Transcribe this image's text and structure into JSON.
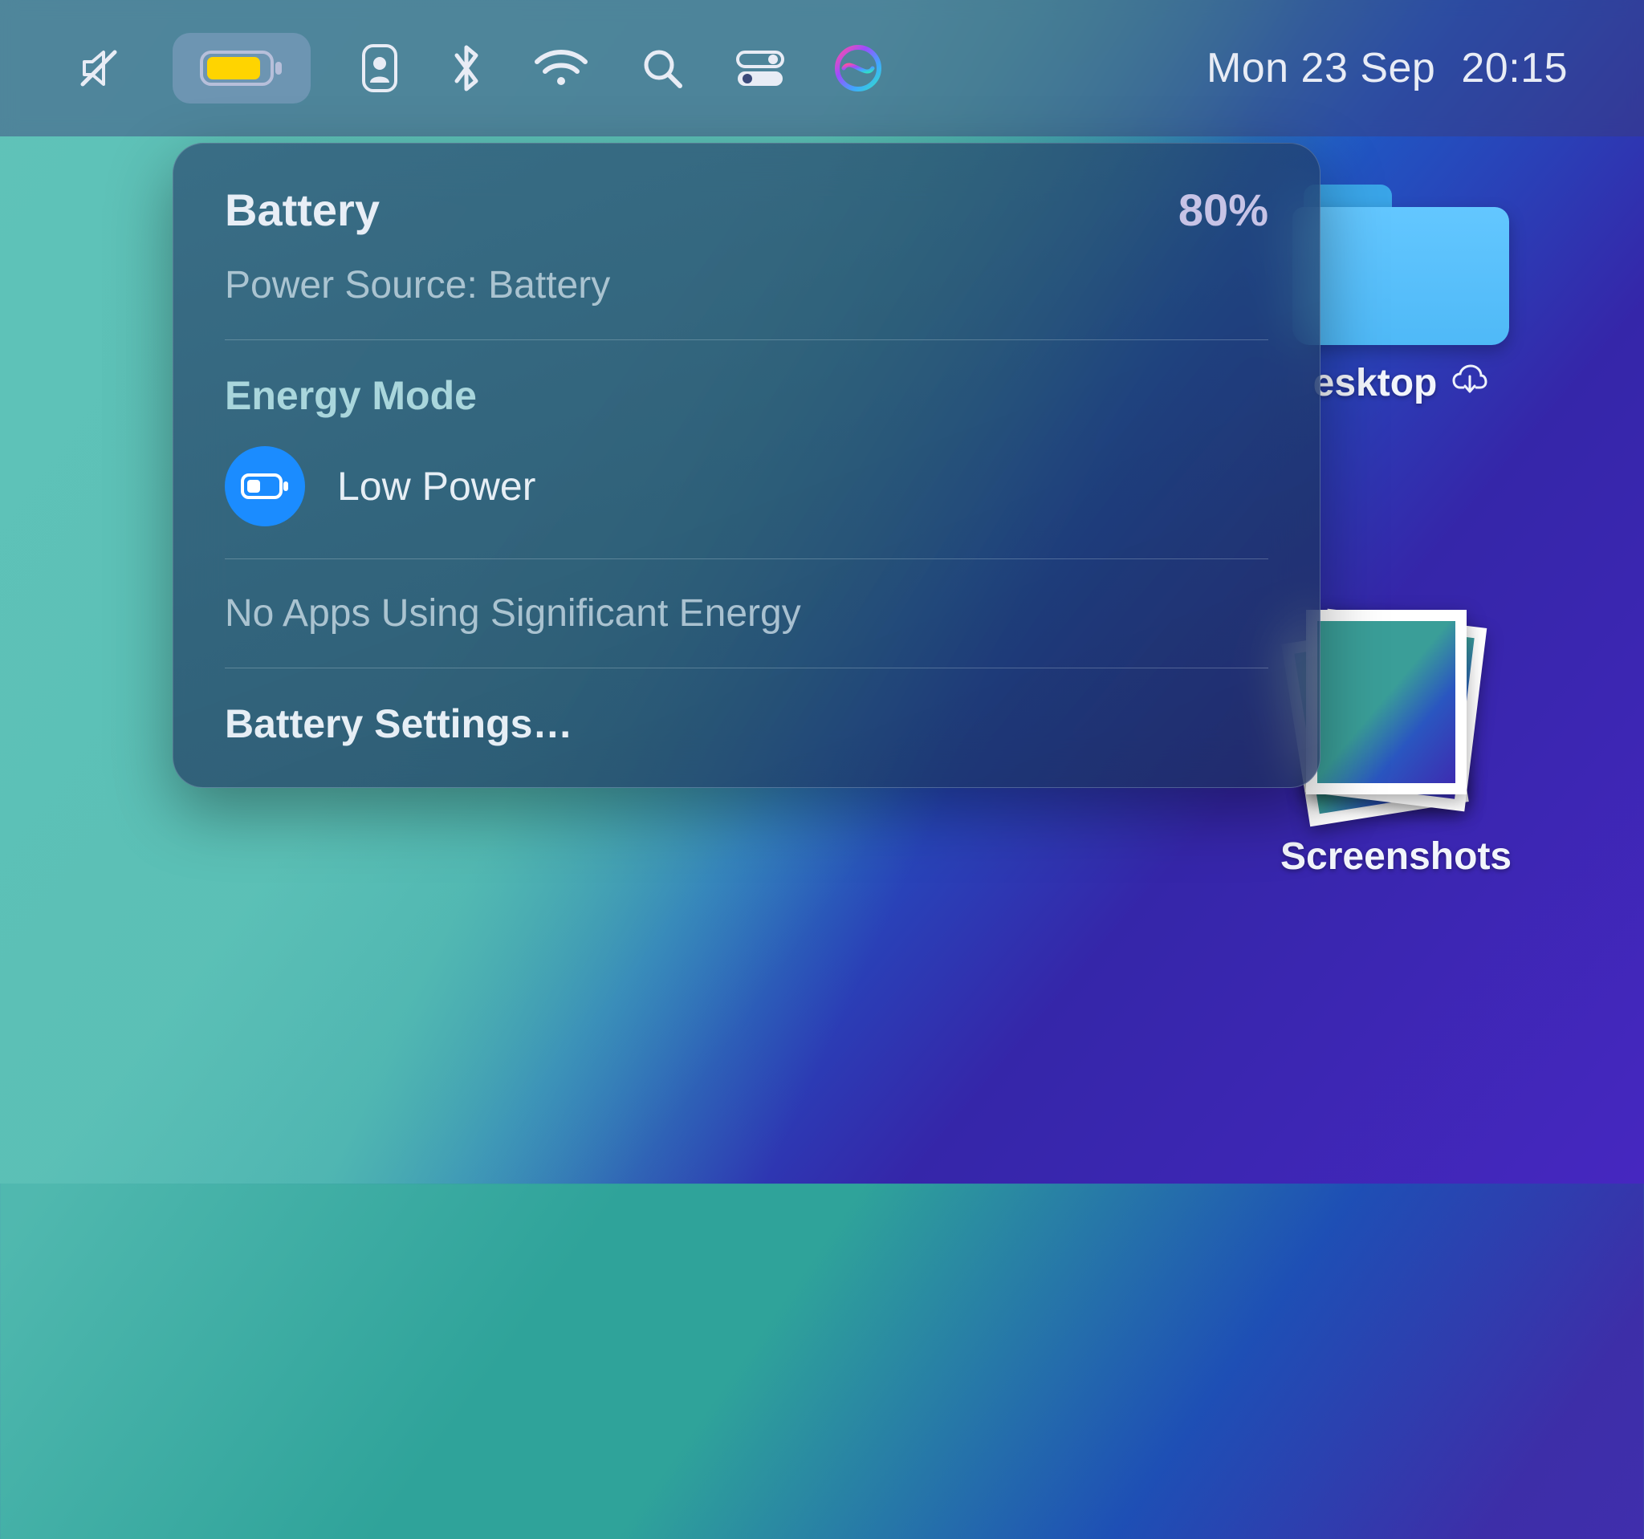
{
  "menubar": {
    "datetime_day": "Mon 23 Sep",
    "datetime_time": "20:15"
  },
  "battery_menu": {
    "title": "Battery",
    "percent": "80%",
    "power_source_line": "Power Source: Battery",
    "energy_mode_heading": "Energy Mode",
    "energy_mode_value": "Low Power",
    "apps_energy_msg": "No Apps Using Significant Energy",
    "settings_link": "Battery Settings…"
  },
  "desktop": {
    "folder_label": "esktop",
    "stack_label": "Screenshots"
  }
}
